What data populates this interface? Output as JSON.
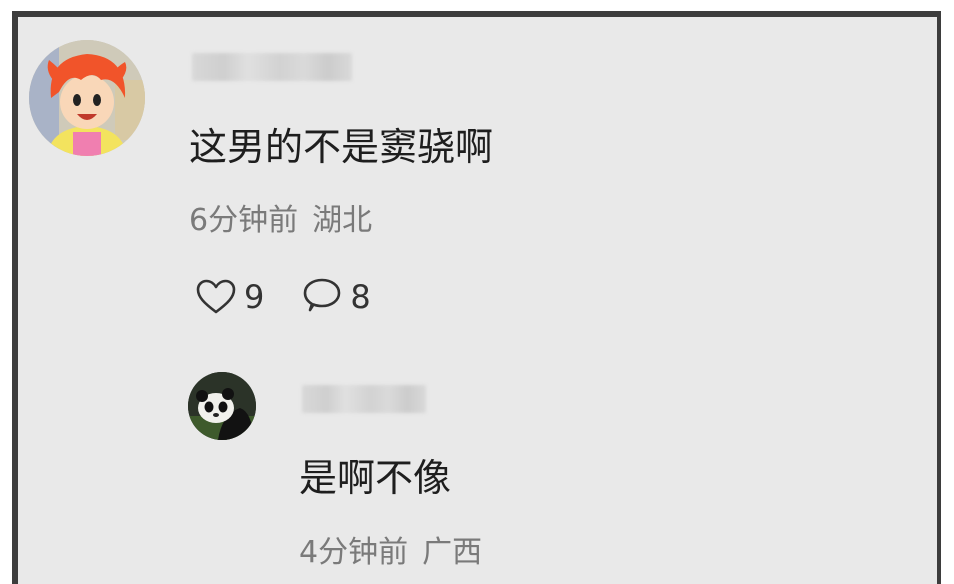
{
  "comment": {
    "text": "这男的不是窦骁啊",
    "time": "6分钟前",
    "location": "湖北",
    "likes": "9",
    "replies": "8",
    "like_icon": "heart-icon",
    "reply_icon": "speech-bubble-icon"
  },
  "reply": {
    "text": "是啊不像",
    "time": "4分钟前",
    "location": "广西"
  },
  "colors": {
    "background": "#e9e9e9",
    "frame": "#3d3d3d",
    "text": "#1e1e1e",
    "meta": "#7a7a7a"
  }
}
